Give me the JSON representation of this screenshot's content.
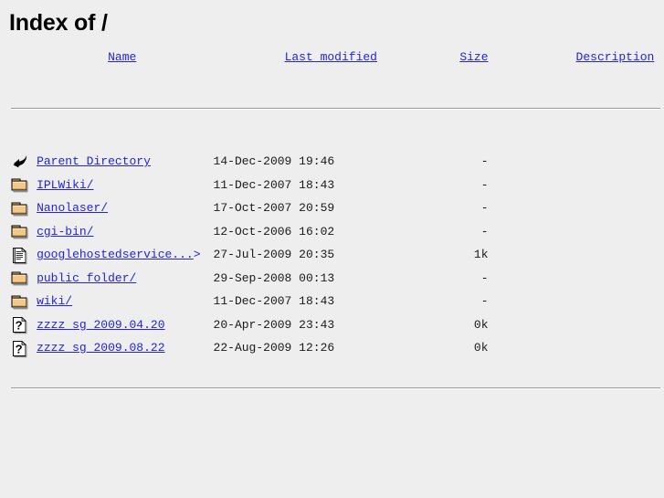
{
  "page": {
    "title": "Index of /"
  },
  "table": {
    "headers": [
      {
        "label": "Name",
        "name": "sort-by-name"
      },
      {
        "label": "Last modified",
        "name": "sort-by-last-modified"
      },
      {
        "label": "Size",
        "name": "sort-by-size"
      },
      {
        "label": "Description",
        "name": "sort-by-description"
      }
    ],
    "rows": [
      {
        "icon": "back-arrow-icon",
        "name": "Parent Directory",
        "last_modified": "14-Dec-2009 19:46",
        "size": "-",
        "description": ""
      },
      {
        "icon": "folder-icon",
        "name": "IPLWiki/",
        "last_modified": "11-Dec-2007 18:43",
        "size": "-",
        "description": ""
      },
      {
        "icon": "folder-icon",
        "name": "Nanolaser/",
        "last_modified": "17-Oct-2007 20:59",
        "size": "-",
        "description": ""
      },
      {
        "icon": "folder-icon",
        "name": "cgi-bin/",
        "last_modified": "12-Oct-2006 16:02",
        "size": "-",
        "description": ""
      },
      {
        "icon": "text-document-icon",
        "name": "googlehostedservice...",
        "name_suffix": ">",
        "last_modified": "27-Jul-2009 20:35",
        "size": "1k",
        "description": ""
      },
      {
        "icon": "folder-icon",
        "name": "public folder/",
        "last_modified": "29-Sep-2008 00:13",
        "size": "-",
        "description": ""
      },
      {
        "icon": "folder-icon",
        "name": "wiki/",
        "last_modified": "11-Dec-2007 18:43",
        "size": "-",
        "description": ""
      },
      {
        "icon": "unknown-file-icon",
        "name": "zzzz sg 2009.04.20",
        "last_modified": "20-Apr-2009 23:43",
        "size": "0k",
        "description": ""
      },
      {
        "icon": "unknown-file-icon",
        "name": "zzzz sg 2009.08.22",
        "last_modified": "22-Aug-2009 12:26",
        "size": "0k",
        "description": ""
      }
    ]
  },
  "colors": {
    "background": "#eeeeee",
    "link": "#2323dc",
    "text": "#000000",
    "rule": "#9a9a9a",
    "folder_body": "#f3c98a",
    "folder_shade": "#d9a867",
    "folder_outline": "#000000"
  }
}
